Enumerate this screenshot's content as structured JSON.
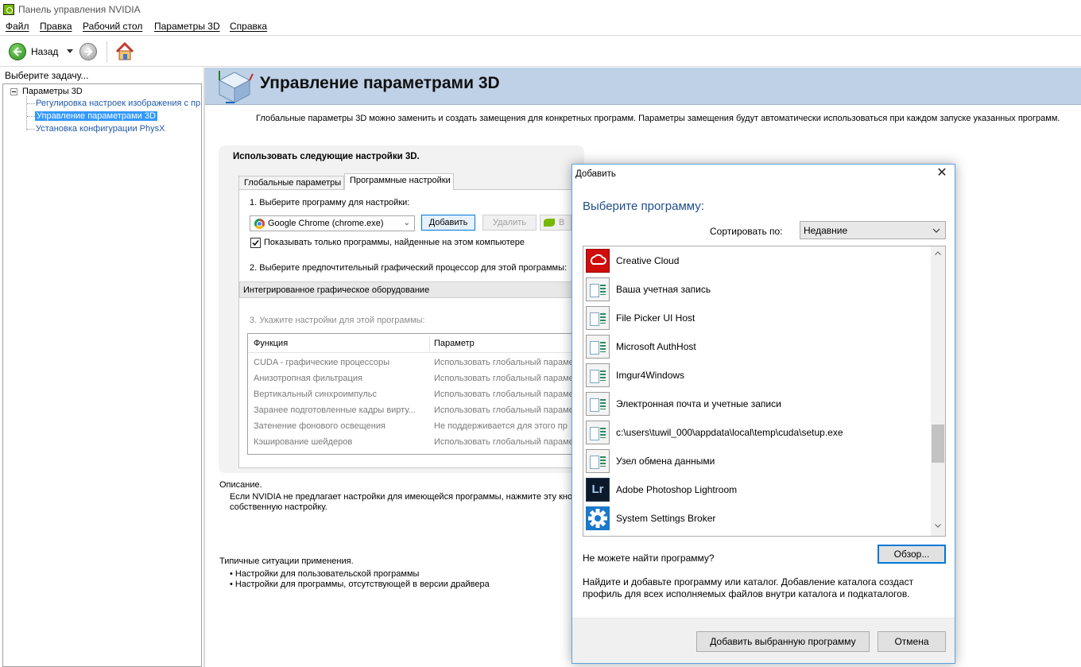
{
  "window": {
    "title": "Панель управления NVIDIA"
  },
  "menu": [
    "Файл",
    "Правка",
    "Рабочий стол",
    "Параметры 3D",
    "Справка"
  ],
  "toolbar": {
    "back_label": "Назад"
  },
  "left_pane": {
    "label": "Выберите задачу...",
    "tree": {
      "root": "Параметры 3D",
      "items": [
        "Регулировка настроек изображения с пр",
        "Управление параметрами 3D",
        "Установка конфигурации PhysX"
      ]
    }
  },
  "main": {
    "title": "Управление параметрами 3D",
    "subtitle": "Глобальные параметры 3D можно заменить и создать замещения для конкретных программ. Параметры замещения будут автоматически использоваться при каждом запуске указанных программ.",
    "box_heading": "Использовать следующие настройки 3D.",
    "tabs": [
      "Глобальные параметры",
      "Программные настройки"
    ],
    "step1": "1. Выберите программу для настройки:",
    "program_selected": "Google Chrome (chrome.exe)",
    "add_button": "Добавить",
    "remove_button": "Удалить",
    "restore_partial": "В",
    "show_only_label": "Показывать только программы, найденные на этом компьютере",
    "step2": "2. Выберите предпочтительный графический процессор для этой программы:",
    "gpu_selected": "Интегрированное графическое оборудование",
    "step3": "3. Укажите настройки для этой программы:",
    "table": {
      "col_function": "Функция",
      "col_param": "Параметр",
      "rows": [
        [
          "CUDA - графические процессоры",
          "Использовать глобальный параме"
        ],
        [
          "Анизотропная фильтрация",
          "Использовать глобальный параме"
        ],
        [
          "Вертикальный синхроимпульс",
          "Использовать глобальный параме"
        ],
        [
          "Заранее подготовленные кадры вирту...",
          "Использовать глобальный параме"
        ],
        [
          "Затенение фонового освещения",
          "Не поддерживается для этого пр"
        ],
        [
          "Кэширование шейдеров",
          "Использовать глобальный параме"
        ]
      ]
    },
    "description_label": "Описание.",
    "description_line1": "Если NVIDIA не предлагает настройки для имеющейся программы, нажмите эту кно",
    "description_line2": "собственную настройку.",
    "usage_label": "Типичные ситуации применения.",
    "usage_items": [
      "• Настройки для пользовательской программы",
      "• Настройки для программы, отсутствующей в версии драйвера"
    ]
  },
  "dialog": {
    "title": "Добавить",
    "heading": "Выберите программу:",
    "sort_label": "Сортировать по:",
    "sort_value": "Недавние",
    "programs": [
      {
        "label": "Creative Cloud",
        "icon": "creative-cloud-icon"
      },
      {
        "label": "Ваша учетная запись",
        "icon": "app-window-icon"
      },
      {
        "label": "File Picker UI Host",
        "icon": "app-window-icon"
      },
      {
        "label": "Microsoft AuthHost",
        "icon": "app-window-icon"
      },
      {
        "label": "Imgur4Windows",
        "icon": "app-window-icon"
      },
      {
        "label": "Электронная почта и учетные записи",
        "icon": "app-window-icon"
      },
      {
        "label": "c:\\users\\tuwil_000\\appdata\\local\\temp\\cuda\\setup.exe",
        "icon": "app-window-icon"
      },
      {
        "label": "Узел обмена данными",
        "icon": "app-window-icon"
      },
      {
        "label": "Adobe Photoshop Lightroom",
        "icon": "lightroom-icon",
        "icon_text": "Lr"
      },
      {
        "label": "System Settings Broker",
        "icon": "gear-icon"
      }
    ],
    "cant_find": "Не можете найти программу?",
    "browse_button": "Обзор...",
    "help_text": "Найдите и добавьте программу или каталог. Добавление каталога создаст профиль для всех исполняемых файлов внутри каталога и подкаталогов.",
    "add_selected_button": "Добавить выбранную программу",
    "cancel_button": "Отмена"
  },
  "colors": {
    "banner": "#bed1e6",
    "link": "#1f5aaa",
    "selection": "#3399ff",
    "nvidia_green": "#76b900",
    "dialog_heading": "#1e4e8c"
  }
}
